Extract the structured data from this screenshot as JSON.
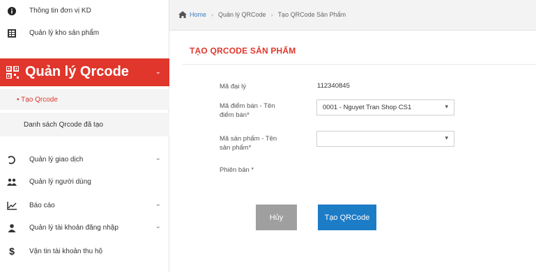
{
  "sidebar": {
    "items": [
      {
        "label": "Thông tin đơn vị KD",
        "icon": "info-circle-icon"
      },
      {
        "label": "Quản lý kho sản phẩm",
        "icon": "grid-list-icon"
      },
      {
        "label": "Quản lý Qrcode",
        "icon": "qrcode-icon",
        "active": true
      },
      {
        "label": "Quản lý giao dịch",
        "icon": "history-icon"
      },
      {
        "label": "Quản lý người dùng",
        "icon": "users-icon"
      },
      {
        "label": "Báo cáo",
        "icon": "line-chart-icon"
      },
      {
        "label": "Quản lý tài khoản đăng nhập",
        "icon": "user-icon"
      },
      {
        "label": "Vận tin tài khoản thu hộ",
        "icon": "dollar-icon"
      }
    ],
    "subitems": [
      {
        "label": "• Tạo Qrcode"
      },
      {
        "label": "Danh sách Qrcode đã tạo"
      }
    ]
  },
  "breadcrumb": {
    "home": "Home",
    "level1": "Quản lý QRCode",
    "level2": "Tạo QRCode Sản Phẩm"
  },
  "page": {
    "title": "TẠO QRCODE SẢN PHẨM"
  },
  "form": {
    "agent_label": "Mã đại lý",
    "agent_value": "112340845",
    "point_label_1": "Mã điểm bán - Tên",
    "point_label_2": "điểm bán*",
    "point_value": "0001 - Nguyet Tran Shop CS1",
    "product_label_1": "Mã sản phẩm - Tên",
    "product_label_2": "sản phẩm*",
    "product_value": "",
    "version_label": "Phiên bản *"
  },
  "buttons": {
    "cancel": "Hủy",
    "create": "Tạo QRCode"
  },
  "colors": {
    "accent": "#e0362c",
    "primary": "#1d7cc6",
    "cancel": "#9f9f9f"
  }
}
